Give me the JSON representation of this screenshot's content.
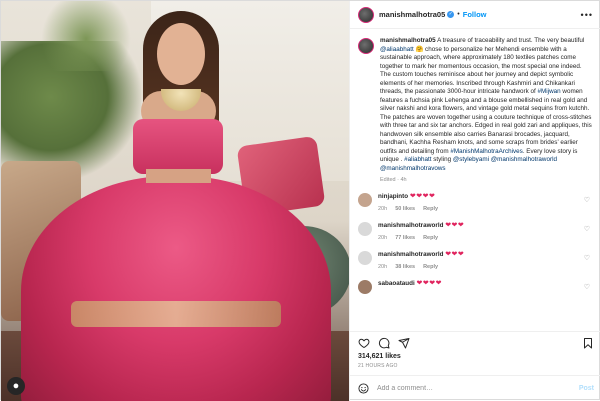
{
  "post": {
    "username": "manishmalhotra05",
    "follow_label": "Follow",
    "more_label": "•••",
    "caption_parts": [
      {
        "t": "A treasure of traceability and trust. The very beautiful ",
        "link": false
      },
      {
        "t": "@aliaabhatt",
        "link": true
      },
      {
        "t": " 🤗 chose to personalize her Mehendi ensemble with a sustainable approach, where approximately 180 textiles patches come together to mark her momentous occasion, the most special one indeed. The custom touches reminisce about her journey and depict symbolic elements of her memories. Inscribed through Kashmiri and Chikankari threads, the passionate 3000-hour intricate handwork of ",
        "link": false
      },
      {
        "t": "#Mijwan",
        "link": true
      },
      {
        "t": " women features a fuchsia pink Lehenga and a blouse embellished in real gold and silver nakshi and kora flowers, and vintage gold metal sequins from kutchh. The patches are woven together using a couture technique of cross-stitches with three tar and six tar anchors. Edged in real gold zari and appliques, this handwoven silk ensemble also carries Banarasi brocades, jacquard, bandhani, Kachha Resham knots, and some scraps from brides' earlier outfits and detailing from ",
        "link": false
      },
      {
        "t": "#ManishMalhotraArchives",
        "link": true
      },
      {
        "t": ". Every love story is unique . ",
        "link": false
      },
      {
        "t": "#aliabhatt",
        "link": true
      },
      {
        "t": " styling ",
        "link": false
      },
      {
        "t": "@stylebyami",
        "link": true
      },
      {
        "t": " ",
        "link": false
      },
      {
        "t": "@manishmalhotraworld",
        "link": true
      },
      {
        "t": " ",
        "link": false
      },
      {
        "t": "@manishmalhotravows",
        "link": true
      }
    ],
    "edited_label": "Edited · 4h",
    "likes": "314,621 likes",
    "time_ago": "21 HOURS AGO",
    "comment_placeholder": "Add a comment…",
    "post_label": "Post"
  },
  "comments": [
    {
      "username": "ninjapinto",
      "text": "❤❤❤❤",
      "age": "20h",
      "likes": "50 likes",
      "reply": "Reply",
      "avatar_color": "#c4a48e"
    },
    {
      "username": "manishmalhotraworld",
      "text": "❤❤❤",
      "age": "20h",
      "likes": "77 likes",
      "reply": "Reply",
      "avatar_color": "#d9d9d9"
    },
    {
      "username": "manishmalhotraworld",
      "text": "❤❤❤",
      "age": "20h",
      "likes": "38 likes",
      "reply": "Reply",
      "avatar_color": "#d9d9d9"
    },
    {
      "username": "sabaoataudi",
      "text": "❤❤❤❤",
      "age": "",
      "likes": "",
      "reply": "",
      "avatar_color": "#9c7b66"
    }
  ],
  "colors": {
    "accent": "#0095f6",
    "link": "#00376b",
    "heart": "#e0245e",
    "muted": "#8e8e8e"
  },
  "icons": [
    "heart-icon",
    "comment-icon",
    "share-icon",
    "bookmark-icon",
    "emoji-icon",
    "more-icon",
    "verified-icon"
  ]
}
